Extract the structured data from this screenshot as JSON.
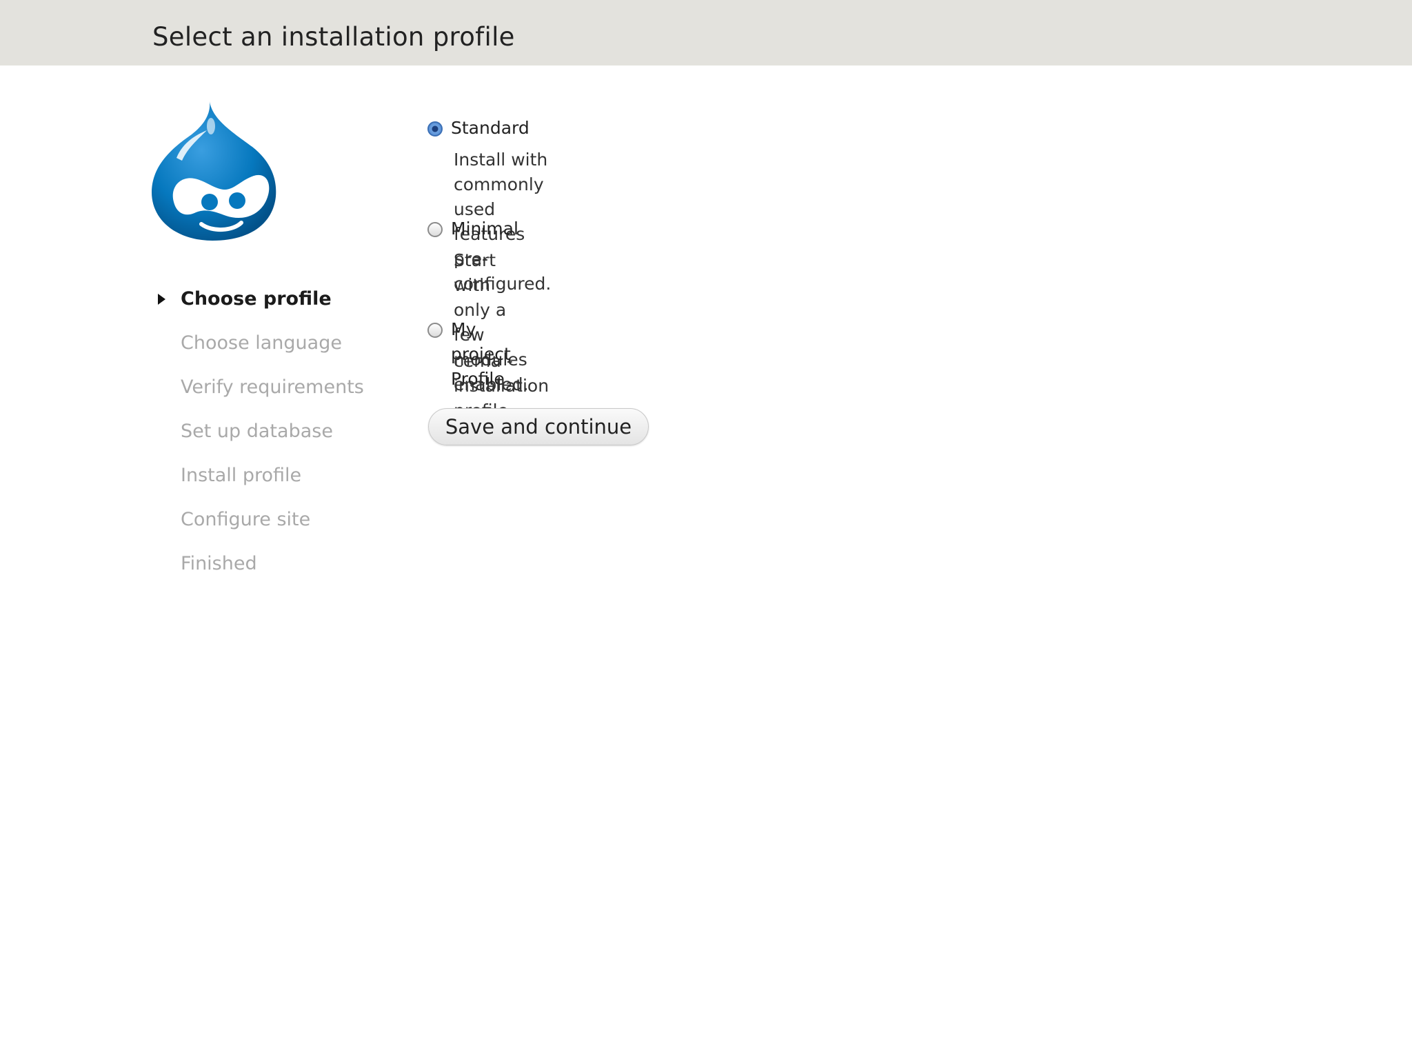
{
  "header": {
    "title": "Select an installation profile"
  },
  "logo": {
    "name": "drupal-drop-logo",
    "color": "#0678be"
  },
  "steps": [
    {
      "label": "Choose profile",
      "active": true
    },
    {
      "label": "Choose language",
      "active": false
    },
    {
      "label": "Verify requirements",
      "active": false
    },
    {
      "label": "Set up database",
      "active": false
    },
    {
      "label": "Install profile",
      "active": false
    },
    {
      "label": "Configure site",
      "active": false
    },
    {
      "label": "Finished",
      "active": false
    }
  ],
  "profiles": [
    {
      "label": "Standard",
      "description": "Install with commonly used features pre-configured.",
      "selected": true
    },
    {
      "label": "Minimal",
      "description": "Start with only a few modules enabled.",
      "selected": false
    },
    {
      "label": "My project Profile",
      "description": "cema - installation profile template.",
      "selected": false
    }
  ],
  "actions": {
    "save_label": "Save and continue"
  }
}
